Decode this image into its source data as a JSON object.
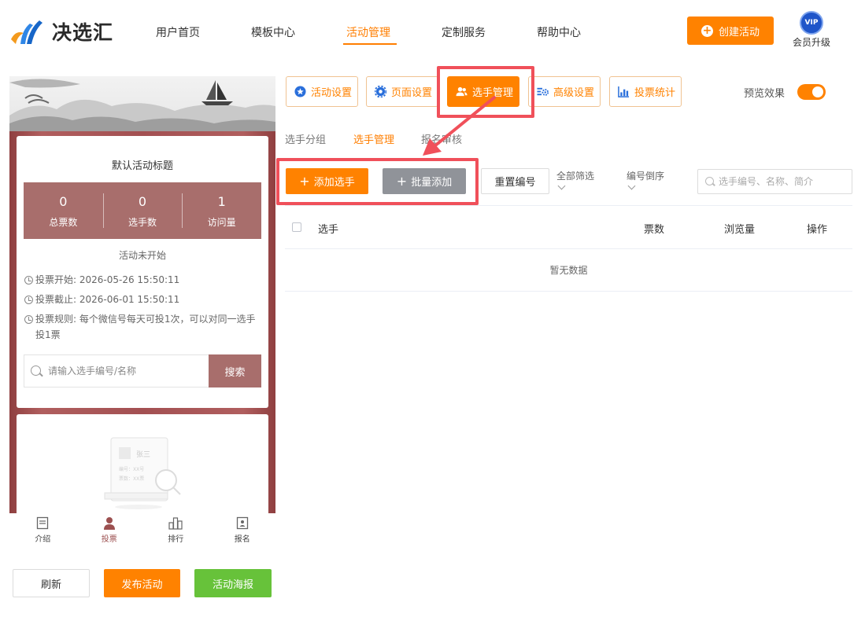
{
  "brand": {
    "name": "决选汇"
  },
  "nav": [
    {
      "label": "用户首页",
      "active": false
    },
    {
      "label": "模板中心",
      "active": false
    },
    {
      "label": "活动管理",
      "active": true
    },
    {
      "label": "定制服务",
      "active": false
    },
    {
      "label": "帮助中心",
      "active": false
    }
  ],
  "header": {
    "create_label": "创建活动",
    "vip_badge": "VIP",
    "vip_label": "会员升级"
  },
  "preview": {
    "title": "默认活动标题",
    "stats": [
      {
        "value": "0",
        "label": "总票数"
      },
      {
        "value": "0",
        "label": "选手数"
      },
      {
        "value": "1",
        "label": "访问量"
      }
    ],
    "status": "活动未开始",
    "vote_start": "投票开始:  2026-05-26 15:50:11",
    "vote_end": "投票截止:  2026-06-01 15:50:11",
    "vote_rule": "投票规则:  每个微信号每天可投1次，可以对同一选手投1票",
    "search_placeholder": "请输入选手编号/名称",
    "search_button": "搜索",
    "sample_card": {
      "name": "张三",
      "line1": "编号：XX号",
      "line2": "票数：XX票"
    },
    "tabs": [
      {
        "label": "介绍",
        "icon": "intro-icon",
        "active": false
      },
      {
        "label": "投票",
        "icon": "vote-user-icon",
        "active": true
      },
      {
        "label": "排行",
        "icon": "ranking-icon",
        "active": false
      },
      {
        "label": "报名",
        "icon": "signup-icon",
        "active": false
      }
    ]
  },
  "preview_actions": {
    "refresh": "刷新",
    "publish": "发布活动",
    "poster": "活动海报"
  },
  "steps": [
    {
      "label": "活动设置",
      "icon": "star-circle-icon",
      "active": false
    },
    {
      "label": "页面设置",
      "icon": "gear-icon",
      "active": false
    },
    {
      "label": "选手管理",
      "icon": "users-icon",
      "active": true
    },
    {
      "label": "高级设置",
      "icon": "advanced-settings-icon",
      "active": false
    },
    {
      "label": "投票统计",
      "icon": "bar-chart-icon",
      "active": false
    }
  ],
  "preview_toggle": {
    "label": "预览效果",
    "on": true
  },
  "subtabs": [
    {
      "label": "选手分组",
      "active": false
    },
    {
      "label": "选手管理",
      "active": true
    },
    {
      "label": "报名审核",
      "active": false
    }
  ],
  "toolbar": {
    "add": "添加选手",
    "batch": "批量添加",
    "renumber": "重置编号",
    "filter_all": "全部筛选",
    "sort": "编号倒序",
    "search_placeholder": "选手编号、名称、简介"
  },
  "table": {
    "columns": [
      "选手",
      "票数",
      "浏览量",
      "操作"
    ],
    "empty_text": "暂无数据"
  },
  "colors": {
    "accent": "#ff8200",
    "theme_red": "#a86e6c",
    "annotation": "#f0505a",
    "green": "#67c23a"
  }
}
